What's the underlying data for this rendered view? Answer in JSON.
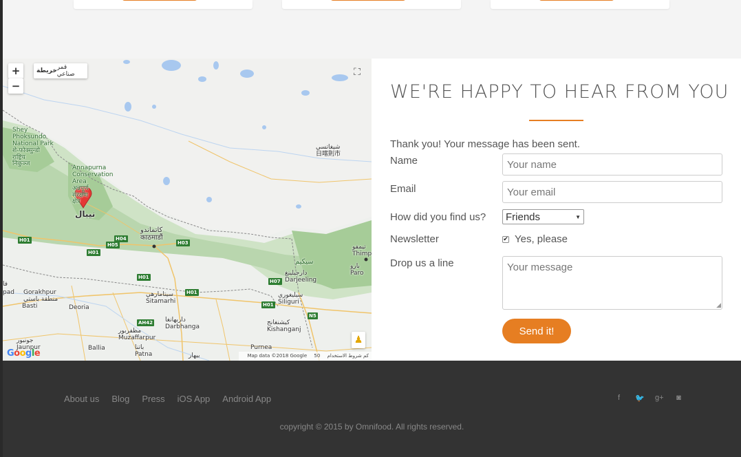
{
  "map": {
    "controls": {
      "zoom_in": "+",
      "zoom_out": "−",
      "map_type_options": [
        "خريطة",
        "قمر صناعي"
      ],
      "selected_map_type": "خريطة"
    },
    "labels": {
      "shey_phoksundo": "Shey\nPhoksundo\nNational Park\nशे-फोक्सुन्डो\nराष्ट्रिय\nनिकुञ्ज",
      "annapurna": "Annapurna\nConservation\nArea\nअन्नपूर्ण\nसंरक्षण\nक्षेत्र",
      "nepal": "نيبال",
      "kathmandu": "كاتماندو\nकाठमाडौं",
      "shigatse": "شيغاتسي\n日喀則市",
      "gorakhpur": "Gorakhpur\nمنطقة باستي",
      "basti": "Basti",
      "deoria": "Deoria",
      "sitamarhi": "سيتامارهي\nSitamarhi",
      "darbhanga": "داربهانغا\nDarbhanga",
      "muzaffarpur": "مظفربور\nMuzaffarpur",
      "patna": "باتنا\nPatna",
      "ballia": "Ballia",
      "jaunpur": "جونبور\nJaunpur",
      "siliguri": "سيليغوري\nSiliguri",
      "kishanganj": "كيشنغانج\nKishanganj",
      "purnea": "Purnea",
      "sikkim": "سيكيم",
      "darjeeling": "دارجيلينغ\nDarjeeling",
      "thimphu": "تيمفو\nThimp",
      "paro": "بارو\nParo",
      "bihar": "بيهار",
      "pad": "pad",
      "fa": "فا"
    },
    "highways": [
      "H01",
      "H04",
      "H05",
      "H01",
      "H03",
      "H01",
      "H01",
      "H07",
      "H01",
      "N5",
      "AH42"
    ],
    "attribution": "Map data ©2018 Google",
    "scale": "50 كم",
    "terms": "شروط الاستخدام",
    "google_logo": "Google"
  },
  "contact": {
    "heading": "WE'RE HAPPY TO HEAR FROM YOU",
    "success_message": "Thank you! Your message has been sent.",
    "name_label": "Name",
    "name_placeholder": "Your name",
    "email_label": "Email",
    "email_placeholder": "Your email",
    "find_label": "How did you find us?",
    "find_selected": "Friends",
    "newsletter_label": "Newsletter",
    "newsletter_checked": true,
    "newsletter_option": "Yes, please",
    "message_label": "Drop us a line",
    "message_placeholder": "Your message",
    "send_button": "Send it!"
  },
  "footer": {
    "nav": [
      "About us",
      "Blog",
      "Press",
      "iOS App",
      "Android App"
    ],
    "social_icons": [
      "facebook-icon",
      "twitter-icon",
      "google-plus-icon",
      "instagram-icon"
    ],
    "social_glyphs": [
      "f",
      "🐦",
      "g+",
      "◙"
    ],
    "copyright": "copyright © 2015 by Omnifood. All rights reserved."
  },
  "colors": {
    "accent": "#e67e22",
    "footer_bg": "#333333",
    "top_bg": "#f4f4f4"
  }
}
